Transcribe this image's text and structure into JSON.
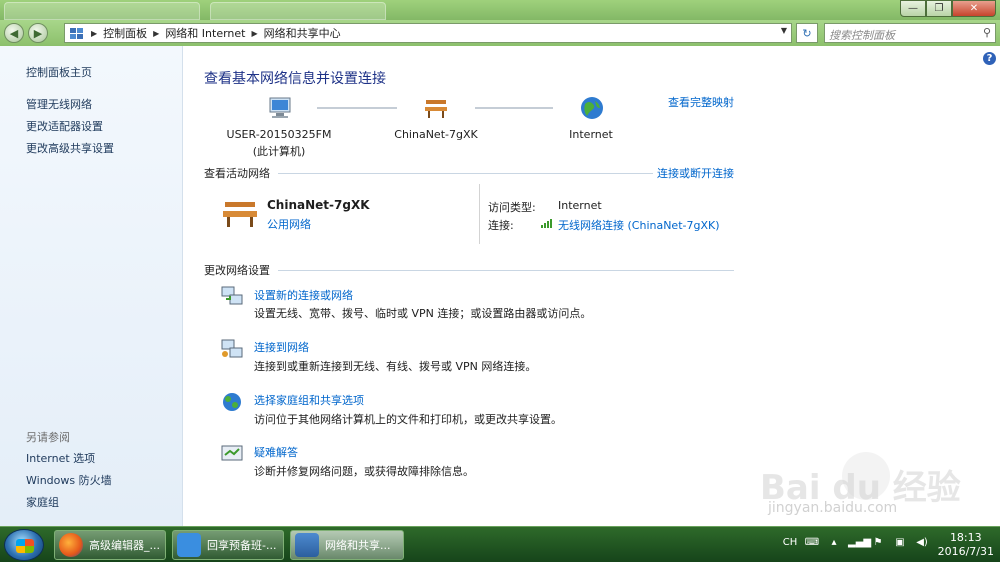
{
  "window": {
    "minimize": "—",
    "maximize": "❐",
    "close": "✕"
  },
  "nav": {
    "back": "◀",
    "forward": "▶",
    "crumbs": [
      "控制面板",
      "网络和 Internet",
      "网络和共享中心"
    ],
    "refresh": "↻",
    "search_placeholder": "搜索控制面板"
  },
  "sidebar": {
    "home": "控制面板主页",
    "items": [
      "管理无线网络",
      "更改适配器设置",
      "更改高级共享设置"
    ],
    "see_also_header": "另请参阅",
    "see_also": [
      "Internet 选项",
      "Windows 防火墙",
      "家庭组"
    ]
  },
  "main": {
    "title": "查看基本网络信息并设置连接",
    "full_map_link": "查看完整映射",
    "nodes": {
      "computer_name": "USER-20150325FM",
      "computer_sub": "(此计算机)",
      "network": "ChinaNet-7gXK",
      "internet": "Internet"
    },
    "active_header": "查看活动网络",
    "connect_disconnect_link": "连接或断开连接",
    "active_network": {
      "name": "ChinaNet-7gXK",
      "type_link": "公用网络",
      "access_label": "访问类型:",
      "access_value": "Internet",
      "conn_label": "连接:",
      "conn_value": "无线网络连接 (ChinaNet-7gXK)"
    },
    "change_header": "更改网络设置",
    "tasks": [
      {
        "title": "设置新的连接或网络",
        "desc": "设置无线、宽带、拨号、临时或 VPN 连接；或设置路由器或访问点。"
      },
      {
        "title": "连接到网络",
        "desc": "连接到或重新连接到无线、有线、拨号或 VPN 网络连接。"
      },
      {
        "title": "选择家庭组和共享选项",
        "desc": "访问位于其他网络计算机上的文件和打印机，或更改共享设置。"
      },
      {
        "title": "疑难解答",
        "desc": "诊断并修复网络问题，或获得故障排除信息。"
      }
    ]
  },
  "watermark": {
    "main": "Bai du 经验",
    "sub": "jingyan.baidu.com"
  },
  "taskbar": {
    "buttons": [
      "高级编辑器_...",
      "回享预备班-...",
      "网络和共享..."
    ],
    "tray_lang": "CH",
    "time": "18:13",
    "date": "2016/7/31"
  }
}
